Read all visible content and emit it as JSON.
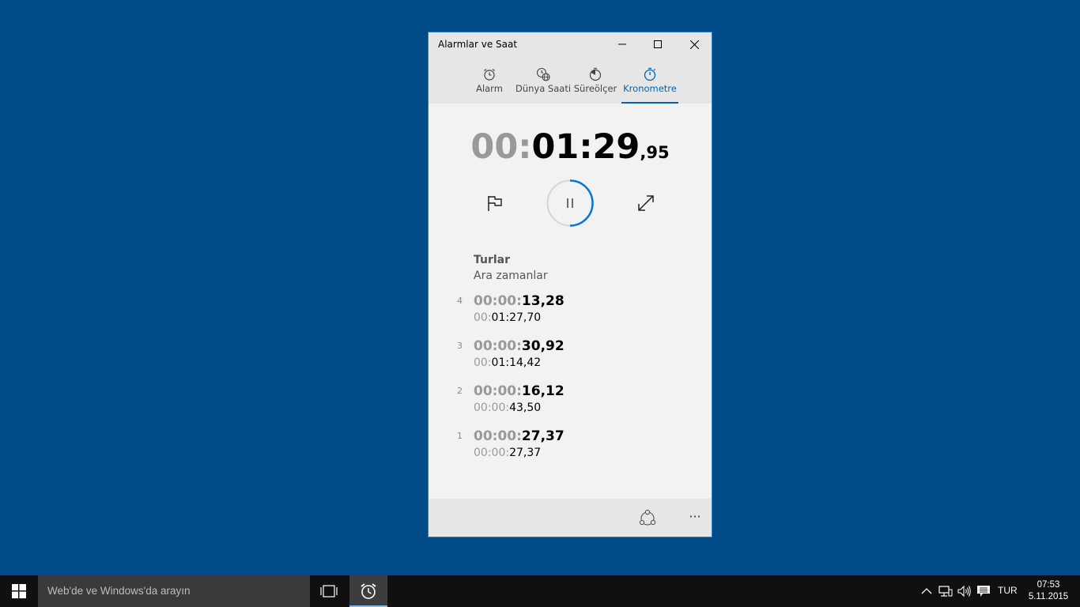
{
  "window": {
    "title": "Alarmlar ve Saat",
    "minimize_glyph": "—",
    "maximize_glyph": "☐",
    "close_glyph": "✕"
  },
  "tabs": [
    {
      "label": "Alarm",
      "icon": "alarm-clock-icon",
      "active": false
    },
    {
      "label": "Dünya Saati",
      "icon": "world-clock-icon",
      "active": false
    },
    {
      "label": "Süreölçer",
      "icon": "timer-icon",
      "active": false
    },
    {
      "label": "Kronometre",
      "icon": "stopwatch-icon",
      "active": true
    }
  ],
  "stopwatch": {
    "hours": "00",
    "sep1": ":",
    "minutes": "01",
    "sep2": ":",
    "seconds": "29",
    "fraction": ",95",
    "progress_fraction": 0.5
  },
  "laps": {
    "title": "Turlar",
    "subtitle": "Ara zamanlar",
    "items": [
      {
        "num": "4",
        "lap_dim": "00:00:",
        "lap_bold": "13,28",
        "split_dim": "00:",
        "split_bold": "01:27,70"
      },
      {
        "num": "3",
        "lap_dim": "00:00:",
        "lap_bold": "30,92",
        "split_dim": "00:",
        "split_bold": "01:14,42"
      },
      {
        "num": "2",
        "lap_dim": "00:00:",
        "lap_bold": "16,12",
        "split_dim": "00:00:",
        "split_bold": "43,50"
      },
      {
        "num": "1",
        "lap_dim": "00:00:",
        "lap_bold": "27,37",
        "split_dim": "00:00:",
        "split_bold": "27,37"
      }
    ]
  },
  "bottombar": {
    "more_label": "···"
  },
  "taskbar": {
    "search_placeholder": "Web'de ve Windows'da arayın",
    "language": "TUR",
    "time": "07:53",
    "date": "5.11.2015"
  },
  "colors": {
    "desktop": "#004b87",
    "accent": "#0063b1",
    "window_border": "#2b79d0",
    "taskbar": "#101010"
  }
}
